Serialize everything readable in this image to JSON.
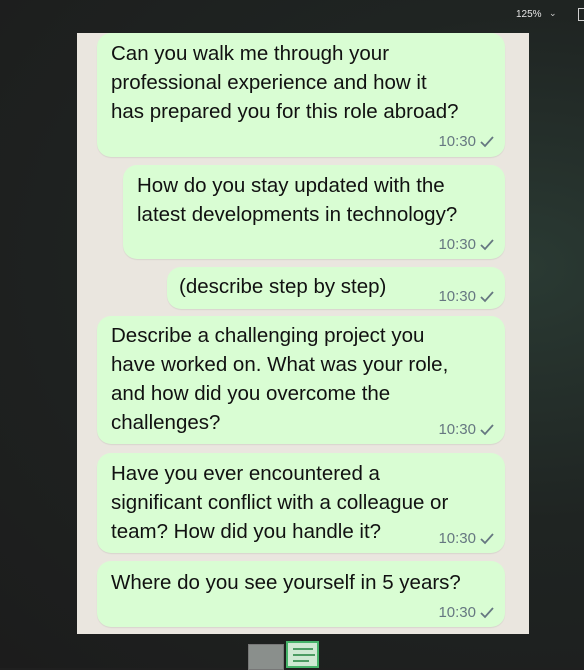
{
  "viewer": {
    "zoom_label": "125%",
    "icons": {
      "zoom_dropdown": "chevron-down-icon",
      "fit": "fit-window-icon"
    }
  },
  "messages": [
    {
      "text": "Can you walk me through your\nprofessional experience and how it\nhas prepared you for this role abroad?",
      "time": "10:30"
    },
    {
      "text": "How do you stay updated with the\nlatest developments in technology?",
      "time": "10:30"
    },
    {
      "text": "(describe step by step)",
      "time": "10:30"
    },
    {
      "text": "Describe a challenging project you\nhave worked on. What was your role,\nand how did you overcome the\nchallenges?",
      "time": "10:30"
    },
    {
      "text": "Have you ever encountered a\nsignificant conflict with a colleague or\nteam? How did you handle it?",
      "time": "10:30"
    },
    {
      "text": "Where do you see yourself in 5 years?",
      "time": "10:30"
    }
  ],
  "colors": {
    "bubble": "#d9fdd3",
    "chat_bg": "#eae6df",
    "meta": "#667781"
  }
}
